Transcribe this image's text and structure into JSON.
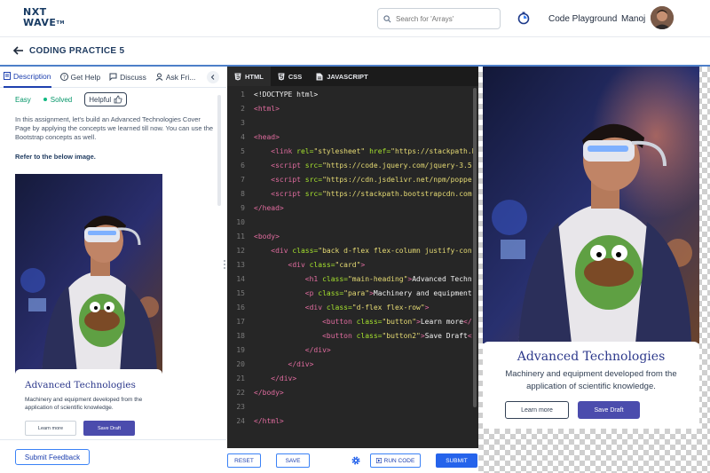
{
  "header": {
    "logo_line1": "NXT",
    "logo_line2": "WAVE",
    "logo_tm": "TM",
    "search_placeholder": "Search for 'Arrays'",
    "code_playground": "Code Playground",
    "username": "Manoj"
  },
  "subheader": {
    "title": "CODING PRACTICE 5"
  },
  "left_panel": {
    "tabs": [
      {
        "label": "Description",
        "icon": "description-icon"
      },
      {
        "label": "Get Help",
        "icon": "help-icon"
      },
      {
        "label": "Discuss",
        "icon": "discuss-icon"
      },
      {
        "label": "Ask Fri...",
        "icon": "ask-friend-icon"
      }
    ],
    "difficulty": "Easy",
    "status": "Solved",
    "helpful": "Helpful",
    "description": "In this assignment, let's build an Advanced Technologies Cover Page by applying the concepts we learned till now. You can use the Bootstrap concepts as well.",
    "refer": "Refer to the below image.",
    "preview": {
      "heading": "Advanced Technologies",
      "para": "Machinery and equipment developed from the application of scientific knowledge.",
      "btn1": "Learn more",
      "btn2": "Save Draft"
    },
    "feedback": "Submit Feedback"
  },
  "editor": {
    "tabs": [
      {
        "label": "HTML",
        "icon": "html5-icon"
      },
      {
        "label": "CSS",
        "icon": "css3-icon"
      },
      {
        "label": "JAVASCRIPT",
        "icon": "js-file-icon"
      }
    ],
    "lines": [
      {
        "n": "1",
        "indent": "",
        "parts": [
          {
            "t": "txt",
            "v": "<!DOCTYPE html>"
          }
        ]
      },
      {
        "n": "2",
        "indent": "",
        "parts": [
          {
            "t": "tag",
            "v": "<html>"
          }
        ]
      },
      {
        "n": "3",
        "indent": "",
        "parts": []
      },
      {
        "n": "4",
        "indent": "",
        "parts": [
          {
            "t": "tag",
            "v": "<head>"
          }
        ]
      },
      {
        "n": "5",
        "indent": "    ",
        "parts": [
          {
            "t": "tag",
            "v": "<link"
          },
          {
            "t": "attr",
            "v": " rel="
          },
          {
            "t": "str",
            "v": "\"stylesheet\""
          },
          {
            "t": "attr",
            "v": " href="
          },
          {
            "t": "str",
            "v": "\"https://stackpath.b"
          }
        ]
      },
      {
        "n": "6",
        "indent": "    ",
        "parts": [
          {
            "t": "tag",
            "v": "<script"
          },
          {
            "t": "attr",
            "v": " src="
          },
          {
            "t": "str",
            "v": "\"https://code.jquery.com/jquery-3.5."
          }
        ]
      },
      {
        "n": "7",
        "indent": "    ",
        "parts": [
          {
            "t": "tag",
            "v": "<script"
          },
          {
            "t": "attr",
            "v": " src="
          },
          {
            "t": "str",
            "v": "\"https://cdn.jsdelivr.net/npm/popper"
          }
        ]
      },
      {
        "n": "8",
        "indent": "    ",
        "parts": [
          {
            "t": "tag",
            "v": "<script"
          },
          {
            "t": "attr",
            "v": " src="
          },
          {
            "t": "str",
            "v": "\"https://stackpath.bootstrapcdn.com"
          }
        ]
      },
      {
        "n": "9",
        "indent": "",
        "parts": [
          {
            "t": "tag",
            "v": "</head>"
          }
        ]
      },
      {
        "n": "10",
        "indent": "",
        "parts": []
      },
      {
        "n": "11",
        "indent": "",
        "parts": [
          {
            "t": "tag",
            "v": "<body>"
          }
        ]
      },
      {
        "n": "12",
        "indent": "    ",
        "parts": [
          {
            "t": "tag",
            "v": "<div"
          },
          {
            "t": "attr",
            "v": " class="
          },
          {
            "t": "str",
            "v": "\"back d-flex flex-column justify-con"
          }
        ]
      },
      {
        "n": "13",
        "indent": "        ",
        "parts": [
          {
            "t": "tag",
            "v": "<div"
          },
          {
            "t": "attr",
            "v": " class="
          },
          {
            "t": "str",
            "v": "\"card\""
          },
          {
            "t": "tag",
            "v": ">"
          }
        ]
      },
      {
        "n": "14",
        "indent": "            ",
        "parts": [
          {
            "t": "tag",
            "v": "<h1"
          },
          {
            "t": "attr",
            "v": " class="
          },
          {
            "t": "str",
            "v": "\"main-heading\""
          },
          {
            "t": "tag",
            "v": ">"
          },
          {
            "t": "txt",
            "v": "Advanced Techn"
          }
        ]
      },
      {
        "n": "15",
        "indent": "            ",
        "parts": [
          {
            "t": "tag",
            "v": "<p"
          },
          {
            "t": "attr",
            "v": " class="
          },
          {
            "t": "str",
            "v": "\"para\""
          },
          {
            "t": "tag",
            "v": ">"
          },
          {
            "t": "txt",
            "v": "Machinery and equipment"
          }
        ]
      },
      {
        "n": "16",
        "indent": "            ",
        "parts": [
          {
            "t": "tag",
            "v": "<div"
          },
          {
            "t": "attr",
            "v": " class="
          },
          {
            "t": "str",
            "v": "\"d-flex flex-row\""
          },
          {
            "t": "tag",
            "v": ">"
          }
        ]
      },
      {
        "n": "17",
        "indent": "                ",
        "parts": [
          {
            "t": "tag",
            "v": "<button"
          },
          {
            "t": "attr",
            "v": " class="
          },
          {
            "t": "str",
            "v": "\"button\""
          },
          {
            "t": "tag",
            "v": ">"
          },
          {
            "t": "txt",
            "v": "Learn more"
          },
          {
            "t": "tag",
            "v": "</"
          }
        ]
      },
      {
        "n": "18",
        "indent": "                ",
        "parts": [
          {
            "t": "tag",
            "v": "<button"
          },
          {
            "t": "attr",
            "v": " class="
          },
          {
            "t": "str",
            "v": "\"button2\""
          },
          {
            "t": "tag",
            "v": ">"
          },
          {
            "t": "txt",
            "v": "Save Draft"
          },
          {
            "t": "tag",
            "v": "<"
          }
        ]
      },
      {
        "n": "19",
        "indent": "            ",
        "parts": [
          {
            "t": "tag",
            "v": "</div>"
          }
        ]
      },
      {
        "n": "20",
        "indent": "        ",
        "parts": [
          {
            "t": "tag",
            "v": "</div>"
          }
        ]
      },
      {
        "n": "21",
        "indent": "    ",
        "parts": [
          {
            "t": "tag",
            "v": "</div>"
          }
        ]
      },
      {
        "n": "22",
        "indent": "",
        "parts": [
          {
            "t": "tag",
            "v": "</body>"
          }
        ]
      },
      {
        "n": "23",
        "indent": "",
        "parts": []
      },
      {
        "n": "24",
        "indent": "",
        "parts": [
          {
            "t": "tag",
            "v": "</html>"
          }
        ]
      }
    ],
    "reset": "RESET",
    "save": "SAVE",
    "run": "RUN CODE",
    "submit": "SUBMIT"
  },
  "output": {
    "heading": "Advanced Technologies",
    "para": "Machinery and equipment developed from the application of scientific knowledge.",
    "btn1": "Learn more",
    "btn2": "Save Draft"
  },
  "colors": {
    "brand_navy": "#183b63",
    "accent_blue": "#2563eb",
    "heading_indigo": "#2e3a8c",
    "button_purple": "#4b4cad",
    "easy_green": "#059669",
    "editor_bg": "#262626"
  }
}
